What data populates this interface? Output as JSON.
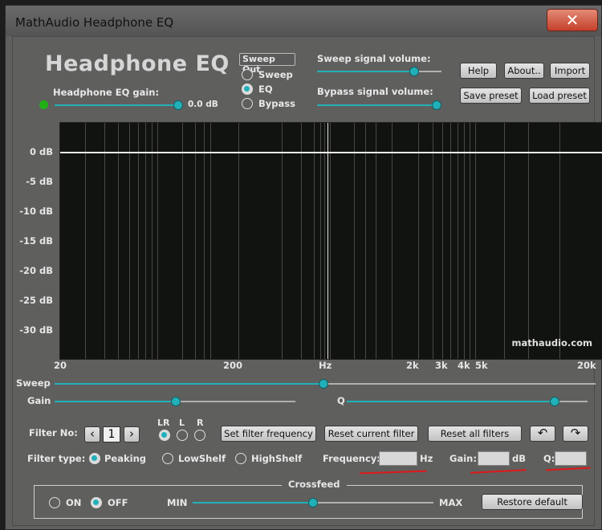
{
  "window": {
    "title": "MathAudio Headphone EQ",
    "close_glyph": "✕"
  },
  "header": {
    "app_title": "Headphone EQ",
    "eq_gain_label": "Headphone EQ gain:",
    "eq_gain_value": "0.0 dB",
    "sweep_out_label": "Sweep Out",
    "modes": [
      "Sweep",
      "EQ",
      "Bypass"
    ],
    "selected_mode": "EQ",
    "sweep_volume_label": "Sweep signal volume:",
    "bypass_volume_label": "Bypass signal volume:",
    "sweep_volume_level": 0.78,
    "bypass_volume_level": 0.95,
    "eq_gain_level": 1.0,
    "buttons": {
      "help": "Help",
      "about": "About..",
      "import": "Import",
      "save_preset": "Save preset",
      "load_preset": "Load preset"
    },
    "status_dot_color": "#22b014"
  },
  "graph": {
    "y_labels": [
      "0 dB",
      "-5 dB",
      "-10 dB",
      "-15 dB",
      "-20 dB",
      "-25 dB",
      "-30 dB"
    ],
    "x_labels": [
      "20",
      "200",
      "Hz",
      "2k",
      "3k",
      "4k",
      "5k",
      "20k"
    ],
    "watermark": "mathaudio.com"
  },
  "sliders": {
    "sweep_label": "Sweep",
    "gain_label": "Gain",
    "q_label": "Q",
    "sweep_level": 0.5,
    "gain_level": 0.5,
    "q_level": 0.85
  },
  "filter": {
    "filter_no_label": "Filter No:",
    "filter_no_value": "1",
    "prev_glyph": "‹",
    "next_glyph": "›",
    "channels": [
      "LR",
      "L",
      "R"
    ],
    "selected_channel": "LR",
    "set_freq_button": "Set filter frequency",
    "reset_current_button": "Reset current filter",
    "reset_all_button": "Reset all filters",
    "undo_glyph": "↶",
    "redo_glyph": "↷",
    "type_label": "Filter type:",
    "types": [
      "Peaking",
      "LowShelf",
      "HighShelf"
    ],
    "selected_type": "Peaking",
    "frequency_label": "Frequency:",
    "frequency_unit": "Hz",
    "frequency_value": "",
    "gain_label": "Gain:",
    "gain_unit": "dB",
    "gain_value": "",
    "q_label": "Q:",
    "q_value": ""
  },
  "crossfeed": {
    "title": "Crossfeed",
    "on_label": "ON",
    "off_label": "OFF",
    "selected": "OFF",
    "min_label": "MIN",
    "max_label": "MAX",
    "level": 0.5,
    "restore_button": "Restore default"
  },
  "colors": {
    "accent": "#22b0b8",
    "panel": "#5f5f5e",
    "graph_bg": "#111310",
    "annotation": "#e01818"
  }
}
